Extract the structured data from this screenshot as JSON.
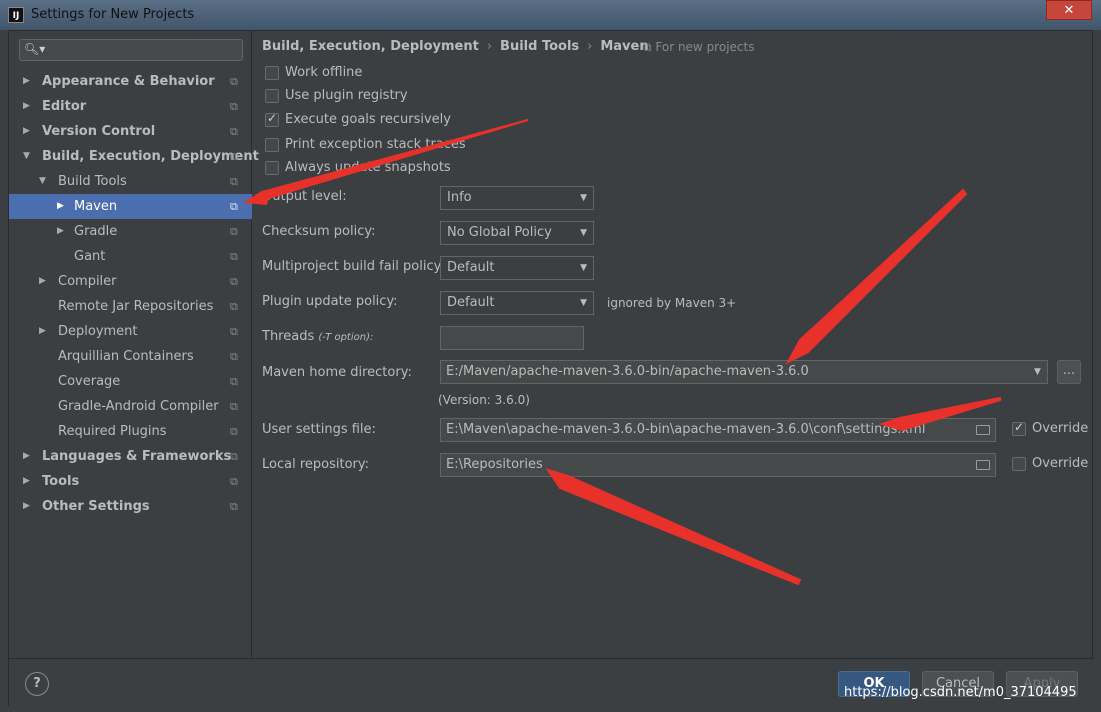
{
  "window": {
    "icon_text": "IJ",
    "title": "Settings for New Projects",
    "close_glyph": "✕"
  },
  "sidebar": {
    "search_glyph": "🔍︎▾",
    "copy_glyph": "⧉",
    "items": [
      {
        "label": "Appearance & Behavior"
      },
      {
        "label": "Editor"
      },
      {
        "label": "Version Control"
      },
      {
        "label": "Build, Execution, Deployment"
      },
      {
        "label": "Build Tools"
      },
      {
        "label": "Maven"
      },
      {
        "label": "Gradle"
      },
      {
        "label": "Gant"
      },
      {
        "label": "Compiler"
      },
      {
        "label": "Remote Jar Repositories"
      },
      {
        "label": "Deployment"
      },
      {
        "label": "Arquillian Containers"
      },
      {
        "label": "Coverage"
      },
      {
        "label": "Gradle-Android Compiler"
      },
      {
        "label": "Required Plugins"
      },
      {
        "label": "Languages & Frameworks"
      },
      {
        "label": "Tools"
      },
      {
        "label": "Other Settings"
      }
    ]
  },
  "breadcrumb": {
    "parts": [
      "Build, Execution, Deployment",
      "Build Tools",
      "Maven"
    ],
    "separator": "›",
    "hint": "⧉ For new projects"
  },
  "checkboxes": [
    {
      "label": "Work offline",
      "checked": false
    },
    {
      "label": "Use plugin registry",
      "checked": false
    },
    {
      "label": "Execute goals recursively",
      "checked": true
    },
    {
      "label": "Print exception stack traces",
      "checked": false
    },
    {
      "label": "Always update snapshots",
      "checked": false
    }
  ],
  "form": {
    "output_level": {
      "label": "Output level:",
      "value": "Info"
    },
    "checksum_policy": {
      "label": "Checksum policy:",
      "value": "No Global Policy"
    },
    "multiproject_policy": {
      "label": "Multiproject build fail policy:",
      "value": "Default"
    },
    "plugin_update_policy": {
      "label": "Plugin update policy:",
      "value": "Default",
      "hint": "ignored by Maven 3+"
    },
    "threads": {
      "label": "Threads",
      "label_suffix": "(-T option):",
      "value": ""
    },
    "maven_home": {
      "label": "Maven home directory:",
      "value": "E:/Maven/apache-maven-3.6.0-bin/apache-maven-3.6.0",
      "browse": "...",
      "version": "(Version: 3.6.0)"
    },
    "user_settings": {
      "label": "User settings file:",
      "value": "E:\\Maven\\apache-maven-3.6.0-bin\\apache-maven-3.6.0\\conf\\settings.xml",
      "override_label": "Override",
      "override_checked": true
    },
    "local_repo": {
      "label": "Local repository:",
      "value": "E:\\Repositories",
      "override_label": "Override",
      "override_checked": false
    },
    "caret_glyph": "▼"
  },
  "footer": {
    "help": "?",
    "ok": "OK",
    "cancel": "Cancel",
    "apply": "Apply",
    "watermark": "https://blog.csdn.net/m0_37104495"
  },
  "colors": {
    "selection": "#4b6eaf",
    "annotation_arrow": "#e8312a"
  }
}
